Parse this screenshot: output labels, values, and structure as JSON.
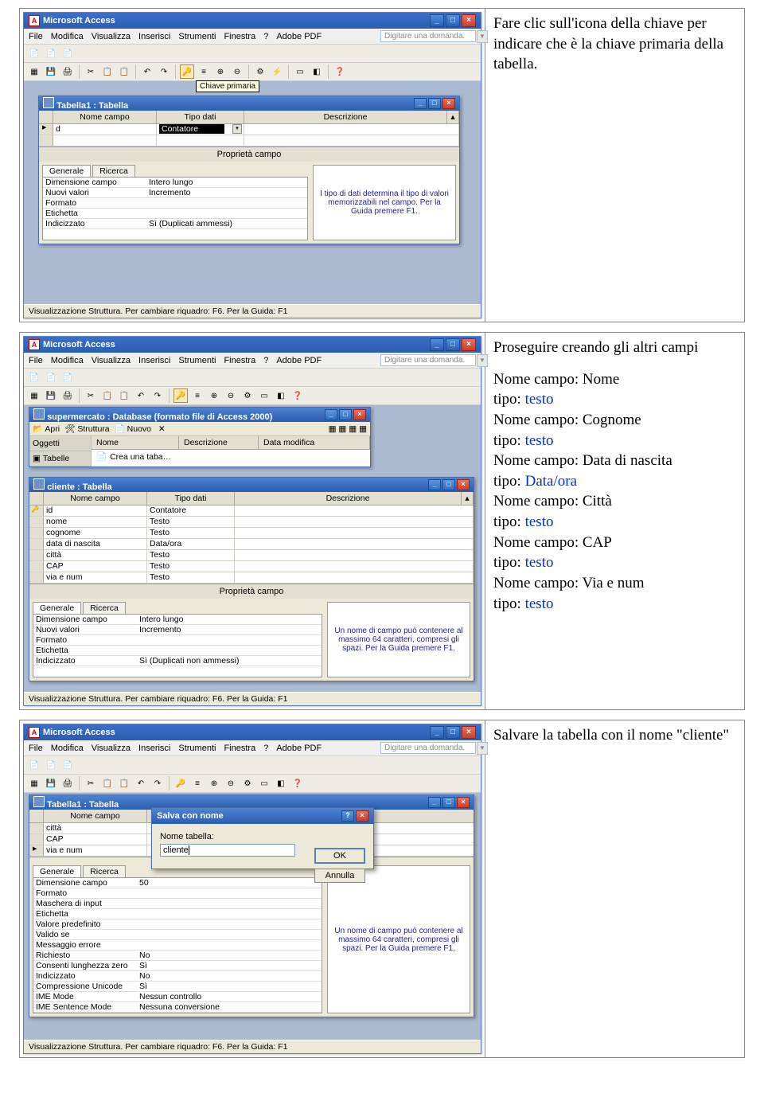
{
  "common": {
    "app_title": "Microsoft Access",
    "menus": [
      "File",
      "Modifica",
      "Visualizza",
      "Inserisci",
      "Strumenti",
      "Finestra",
      "?",
      "Adobe PDF"
    ],
    "help_prompt": "Digitare una domanda.",
    "status": "Visualizzazione Struttura. Per cambiare riquadro: F6. Per la Guida: F1",
    "win_buttons": {
      "min": "_",
      "max": "□",
      "close": "×"
    },
    "toolbar_icons": [
      "view-icon",
      "save-icon",
      "print-icon",
      "preview-icon",
      "spell-icon",
      "cut-icon",
      "copy-icon",
      "paste-icon",
      "undo-icon",
      "redo-icon",
      "key-icon",
      "rows-icon",
      "insert-row-icon",
      "delete-row-icon",
      "props-icon",
      "index-icon",
      "db-window-icon",
      "obj-icon",
      "help-icon"
    ],
    "props_title": "Proprietà campo",
    "props_tabs": {
      "general": "Generale",
      "lookup": "Ricerca"
    }
  },
  "panel1": {
    "tooltip": "Chiave primaria",
    "child_title": "Tabella1 : Tabella",
    "headers": {
      "field": "Nome campo",
      "type": "Tipo dati",
      "desc": "Descrizione"
    },
    "row": {
      "name": "d",
      "type": "Contatore"
    },
    "props": [
      {
        "label": "Dimensione campo",
        "value": "Intero lungo"
      },
      {
        "label": "Nuovi valori",
        "value": "Incremento"
      },
      {
        "label": "Formato",
        "value": ""
      },
      {
        "label": "Etichetta",
        "value": ""
      },
      {
        "label": "Indicizzato",
        "value": "Sì (Duplicati ammessi)"
      }
    ],
    "help_text": "I tipo di dati determina il tipo di valori memorizzabili nel campo. Per la Guida premere F1.",
    "instruction": "Fare clic sull'icona della chiave per indicare che è la chiave primaria della tabella."
  },
  "panel2": {
    "db_title": "supermercato : Database (formato file di Access 2000)",
    "db_tools": [
      "Apri",
      "Struttura",
      "Nuovo"
    ],
    "db_side_tab": "Tabelle",
    "db_list_headers": [
      "Oggetti",
      "Nome",
      "Descrizione",
      "Data modifica"
    ],
    "db_item1": "Crea una taba…",
    "child_title": "cliente : Tabella",
    "headers": {
      "field": "Nome campo",
      "type": "Tipo dati",
      "desc": "Descrizione"
    },
    "rows": [
      {
        "name": "id",
        "type": "Contatore",
        "key": true
      },
      {
        "name": "nome",
        "type": "Testo"
      },
      {
        "name": "cognome",
        "type": "Testo"
      },
      {
        "name": "data di nascita",
        "type": "Data/ora"
      },
      {
        "name": "città",
        "type": "Testo"
      },
      {
        "name": "CAP",
        "type": "Testo"
      },
      {
        "name": "via e num",
        "type": "Testo"
      }
    ],
    "props": [
      {
        "label": "Dimensione campo",
        "value": "Intero lungo"
      },
      {
        "label": "Nuovi valori",
        "value": "Incremento"
      },
      {
        "label": "Formato",
        "value": ""
      },
      {
        "label": "Etichetta",
        "value": ""
      },
      {
        "label": "Indicizzato",
        "value": "Sì (Duplicati non ammessi)"
      }
    ],
    "help_text": "Un nome di campo può contenere al massimo 64 caratteri, compresi gli spazi. Per la Guida premere F1.",
    "instruction_intro": "Proseguire creando gli altri campi",
    "fields": [
      {
        "namelabel": "Nome campo: ",
        "name": "Nome",
        "typelabel": "tipo: ",
        "type": "testo"
      },
      {
        "namelabel": "Nome campo: ",
        "name": "Cognome",
        "typelabel": "tipo: ",
        "type": "testo"
      },
      {
        "namelabel": "Nome campo: ",
        "name": "Data di nascita",
        "typelabel": "tipo: ",
        "type": "Data/ora"
      },
      {
        "namelabel": "Nome campo: ",
        "name": "Città",
        "typelabel": "tipo: ",
        "type": "testo"
      },
      {
        "namelabel": "Nome campo: ",
        "name": "CAP",
        "typelabel": "tipo: ",
        "type": "testo"
      },
      {
        "namelabel": "Nome campo: ",
        "name": "Via e num",
        "typelabel": "tipo: ",
        "type": "testo"
      }
    ]
  },
  "panel3": {
    "child_title": "Tabella1 : Tabella",
    "headers": {
      "field": "Nome campo"
    },
    "visible_rows": [
      {
        "name": "città"
      },
      {
        "name": "CAP"
      },
      {
        "name": "via e num",
        "arrow": true
      }
    ],
    "save_dlg": {
      "title": "Salva con nome",
      "label": "Nome tabella:",
      "value": "cliente",
      "ok": "OK",
      "cancel": "Annulla"
    },
    "help_text": "Un nome di campo può contenere al massimo 64 caratteri, compresi gli spazi. Per la Guida premere F1.",
    "props": [
      {
        "label": "Dimensione campo",
        "value": "50"
      },
      {
        "label": "Formato",
        "value": ""
      },
      {
        "label": "Maschera di input",
        "value": ""
      },
      {
        "label": "Etichetta",
        "value": ""
      },
      {
        "label": "Valore predefinito",
        "value": ""
      },
      {
        "label": "Valido se",
        "value": ""
      },
      {
        "label": "Messaggio errore",
        "value": ""
      },
      {
        "label": "Richiesto",
        "value": "No"
      },
      {
        "label": "Consenti lunghezza zero",
        "value": "Sì"
      },
      {
        "label": "Indicizzato",
        "value": "No"
      },
      {
        "label": "Compressione Unicode",
        "value": "Sì"
      },
      {
        "label": "IME Mode",
        "value": "Nessun controllo"
      },
      {
        "label": "IME Sentence Mode",
        "value": "Nessuna conversione"
      }
    ],
    "instruction": "Salvare la tabella con il nome \"cliente\""
  }
}
